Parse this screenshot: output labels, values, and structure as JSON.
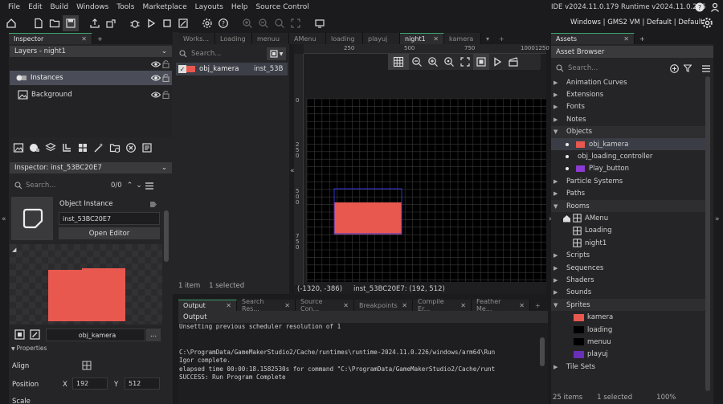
{
  "menu": [
    "File",
    "Edit",
    "Build",
    "Windows",
    "Tools",
    "Marketplace",
    "Layouts",
    "Help",
    "Source Control"
  ],
  "ide_version": "IDE v2024.11.0.179  Runtime v2024.11.0.226",
  "target": "Windows | GMS2 VM | Default | Default",
  "inspector": {
    "tab": "Inspector",
    "layers_title": "Layers - night1",
    "layers": [
      {
        "name": "Instances",
        "selected": true
      },
      {
        "name": "Background",
        "selected": false
      }
    ],
    "section_title": "Inspector: inst_53BC20E7",
    "search_placeholder": "Search...",
    "count": "0/0",
    "object_instance_label": "Object Instance",
    "instance_name": "inst_53BC20E7",
    "open_editor": "Open Editor",
    "object_name": "obj_kamera",
    "more": "...",
    "properties_label": "Properties",
    "align_label": "Align",
    "position_label": "Position",
    "x_label": "X",
    "x_value": "192",
    "y_label": "Y",
    "y_value": "512",
    "scale_label": "Scale",
    "sprite_color": "#e8584f"
  },
  "instances_panel": {
    "search_placeholder": "Search...",
    "items": [
      {
        "name": "obj_kamera",
        "id": "inst_53B",
        "color": "#e8584f",
        "checked": true
      }
    ],
    "status": "1 item    1 selected"
  },
  "editor_tabs": [
    {
      "label": "Works...",
      "active": false
    },
    {
      "label": "Loading",
      "active": false
    },
    {
      "label": "menuu",
      "active": false
    },
    {
      "label": "AMenu",
      "active": false
    },
    {
      "label": "loading",
      "active": false
    },
    {
      "label": "playuj",
      "active": false
    },
    {
      "label": "night1",
      "active": true
    },
    {
      "label": "kamera",
      "active": false
    }
  ],
  "room": {
    "ruler_top": [
      "250",
      "500",
      "750",
      "1000",
      "1250"
    ],
    "ruler_left": [
      "0",
      "250",
      "500",
      "750"
    ],
    "coords": "(-1320, -386)",
    "hover_info": "inst_53BC20E7: (192, 512)",
    "zoom": "100%",
    "grid_color": "#3a3a3a",
    "rect_color": "#e8584f",
    "bbox_color": "#3232d8"
  },
  "output": {
    "tabs": [
      {
        "label": "Output",
        "active": true
      },
      {
        "label": "Search Res...",
        "active": false
      },
      {
        "label": "Source Con...",
        "active": false
      },
      {
        "label": "Breakpoints",
        "active": false
      },
      {
        "label": "Compile Er...",
        "active": false
      },
      {
        "label": "Feather Me...",
        "active": false
      }
    ],
    "title": "Output",
    "lines": [
      "Unsetting previous scheduler resolution of 1",
      "",
      "",
      "C:\\ProgramData/GameMakerStudio2/Cache/runtimes\\runtime-2024.11.0.226/windows/arm64\\Run",
      "Igor complete.",
      "elapsed time 00:00:18.1582530s for command \"C:\\ProgramData/GameMakerStudio2/Cache/runt",
      "SUCCESS: Run Program Complete"
    ]
  },
  "assets": {
    "tab": "Assets",
    "browser_title": "Asset Browser",
    "search_placeholder": "Search...",
    "status_items": "25 items",
    "status_selected": "1 selected",
    "status_zoom": "100%",
    "tree": [
      {
        "label": "Animation Curves",
        "type": "folder",
        "level": 0,
        "expanded": false
      },
      {
        "label": "Extensions",
        "type": "folder",
        "level": 0,
        "expanded": false
      },
      {
        "label": "Fonts",
        "type": "folder",
        "level": 0,
        "expanded": false
      },
      {
        "label": "Notes",
        "type": "folder",
        "level": 0,
        "expanded": false
      },
      {
        "label": "Objects",
        "type": "folder",
        "level": 0,
        "expanded": true
      },
      {
        "label": "obj_kamera",
        "type": "object",
        "level": 1,
        "color": "#e8584f",
        "highlight": true
      },
      {
        "label": "obj_loading_controller",
        "type": "object",
        "level": 1,
        "color": ""
      },
      {
        "label": "Play_button",
        "type": "object",
        "level": 1,
        "color": "#8b3bd1"
      },
      {
        "label": "Particle Systems",
        "type": "folder",
        "level": 0,
        "expanded": false
      },
      {
        "label": "Paths",
        "type": "folder",
        "level": 0,
        "expanded": false
      },
      {
        "label": "Rooms",
        "type": "folder",
        "level": 0,
        "expanded": true
      },
      {
        "label": "AMenu",
        "type": "room-home",
        "level": 1
      },
      {
        "label": "Loading",
        "type": "room",
        "level": 1
      },
      {
        "label": "night1",
        "type": "room",
        "level": 1
      },
      {
        "label": "Scripts",
        "type": "folder",
        "level": 0,
        "expanded": false
      },
      {
        "label": "Sequences",
        "type": "folder",
        "level": 0,
        "expanded": false
      },
      {
        "label": "Shaders",
        "type": "folder",
        "level": 0,
        "expanded": false
      },
      {
        "label": "Sounds",
        "type": "folder",
        "level": 0,
        "expanded": false
      },
      {
        "label": "Sprites",
        "type": "folder",
        "level": 0,
        "expanded": true
      },
      {
        "label": "kamera",
        "type": "sprite",
        "level": 1,
        "color": "#e8584f"
      },
      {
        "label": "loading",
        "type": "sprite",
        "level": 1,
        "color": "#000000"
      },
      {
        "label": "menuu",
        "type": "sprite",
        "level": 1,
        "color": "#000000"
      },
      {
        "label": "playuj",
        "type": "sprite",
        "level": 1,
        "color": "#6a2fb8"
      },
      {
        "label": "Tile Sets",
        "type": "folder",
        "level": 0,
        "expanded": false
      }
    ]
  }
}
